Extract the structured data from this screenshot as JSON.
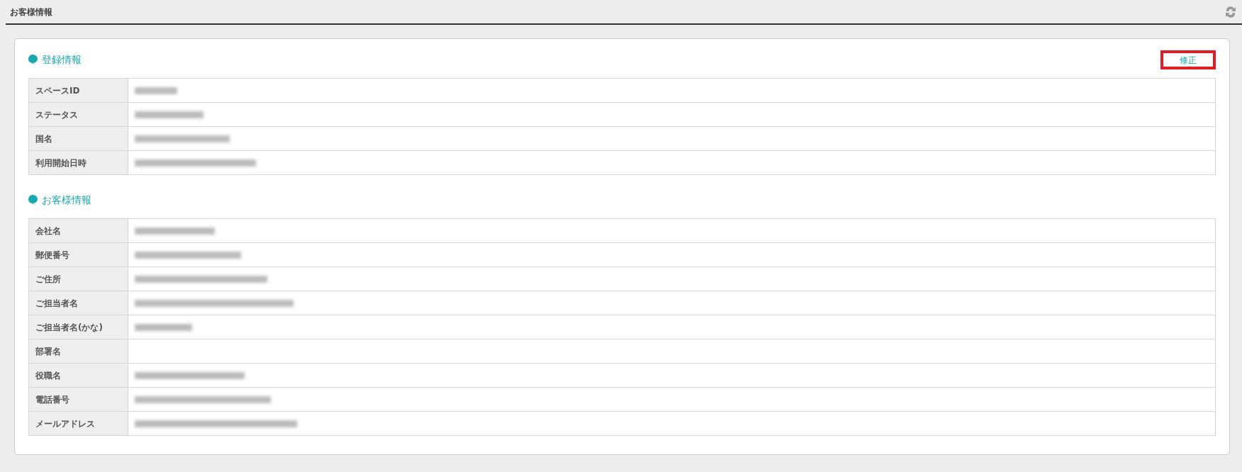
{
  "page": {
    "title": "お客様情報"
  },
  "sections": [
    {
      "title": "登録情報",
      "action": "修正",
      "action_highlighted": true,
      "rows": [
        {
          "label": "スペースID",
          "redacted": true
        },
        {
          "label": "ステータス",
          "redacted": true
        },
        {
          "label": "国名",
          "redacted": true
        },
        {
          "label": "利用開始日時",
          "redacted": true
        }
      ]
    },
    {
      "title": "お客様情報",
      "rows": [
        {
          "label": "会社名",
          "redacted": true
        },
        {
          "label": "郵便番号",
          "redacted": true
        },
        {
          "label": "ご住所",
          "redacted": true
        },
        {
          "label": "ご担当者名",
          "redacted": true
        },
        {
          "label": "ご担当者名(かな)",
          "redacted": true
        },
        {
          "label": "部署名",
          "redacted": false
        },
        {
          "label": "役職名",
          "redacted": true
        },
        {
          "label": "電話番号",
          "redacted": true
        },
        {
          "label": "メールアドレス",
          "redacted": true
        }
      ]
    }
  ]
}
